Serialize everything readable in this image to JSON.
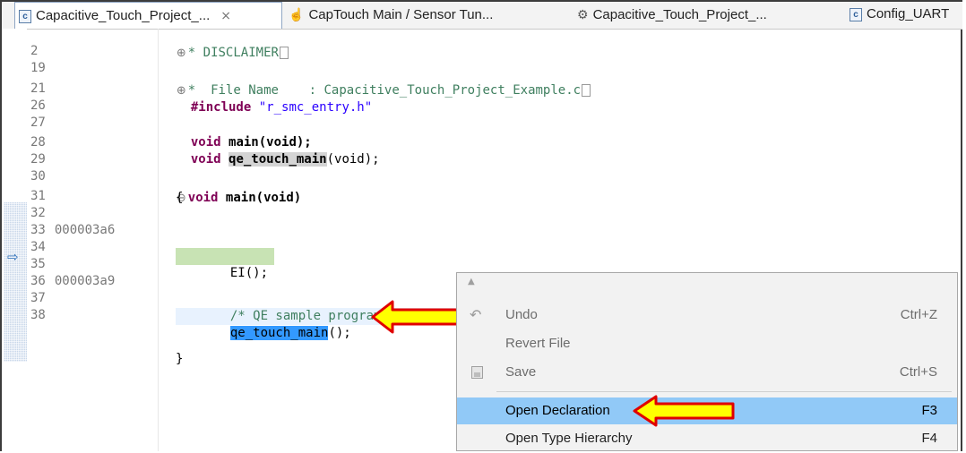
{
  "tabs": [
    {
      "label": "Capacitive_Touch_Project_...",
      "icon": "c-file-icon",
      "active": true,
      "close": "⨯"
    },
    {
      "label": "CapTouch Main / Sensor Tun...",
      "icon": "touch-icon"
    },
    {
      "label": "Capacitive_Touch_Project_...",
      "icon": "gear-icon"
    },
    {
      "label": "Config_UART",
      "icon": "c-file-icon"
    }
  ],
  "editor": {
    "line_numbers": [
      "2",
      "19",
      "21",
      "26",
      "27",
      "28",
      "29",
      "30",
      "31",
      "32",
      "33",
      "34",
      "35",
      "36",
      "37",
      "38"
    ],
    "addresses": {
      "33": "000003a6",
      "36": "000003a9"
    },
    "code": {
      "l2": "DISCLAIMER",
      "l21_a": "File Name",
      "l21_b": ": Capacitive_Touch_Project_Example.c",
      "include_kw": "#include",
      "include_str": "\"r_smc_entry.h\"",
      "void_kw": "void",
      "main_decl": "main(void);",
      "qe_main": "qe_touch_main",
      "qe_rest": "(void);",
      "main_def_rest": "main(void)",
      "open_brace": "{",
      "ei_call": "EI();",
      "comment": "/* QE sample program */",
      "call_name": "qe_touch_main",
      "call_rest": "();",
      "close_brace": "}",
      "star": "*"
    }
  },
  "context_menu": {
    "items": [
      {
        "label": "Undo",
        "shortcut": "Ctrl+Z",
        "disabled": true
      },
      {
        "label": "Revert File",
        "shortcut": "",
        "disabled": true
      },
      {
        "label": "Save",
        "shortcut": "Ctrl+S",
        "disabled": true
      },
      {
        "label": "Open Declaration",
        "shortcut": "F3",
        "active": true
      },
      {
        "label": "Open Type Hierarchy",
        "shortcut": "F4"
      }
    ]
  },
  "colors": {
    "callout_fill": "#ffff00",
    "callout_stroke": "#e00000",
    "selection": "#3399ff",
    "menu_highlight": "#91c9f7"
  }
}
